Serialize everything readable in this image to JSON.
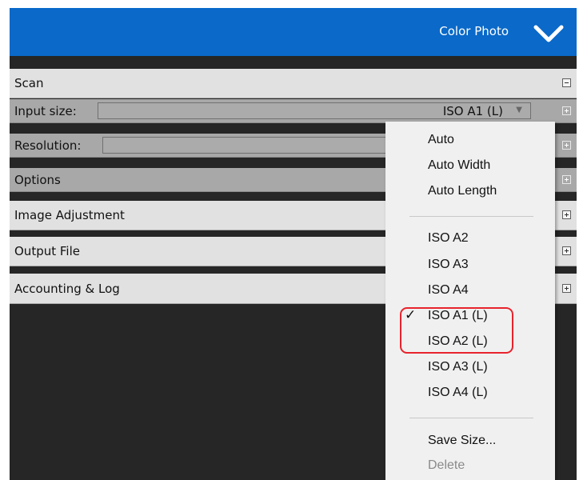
{
  "header": {
    "title": "Color Photo",
    "expand_icon": "chevron-down-icon"
  },
  "panels": {
    "scan": {
      "label": "Scan",
      "state_icon": "collapse-minus-icon"
    },
    "input_size": {
      "label": "Input size:",
      "value": "ISO A1 (L)",
      "state_icon": "expand-plus-icon"
    },
    "resolution": {
      "label": "Resolution:",
      "state_icon": "expand-plus-icon"
    },
    "options": {
      "label": "Options",
      "state_icon": "expand-plus-icon"
    },
    "image_adjustment": {
      "label": "Image Adjustment",
      "state_icon": "expand-plus-icon"
    },
    "output_file": {
      "label": "Output File",
      "state_icon": "expand-plus-icon"
    },
    "accounting_log": {
      "label": "Accounting & Log",
      "state_icon": "expand-plus-icon"
    }
  },
  "dropdown": {
    "items": [
      "Auto",
      "Auto Width",
      "Auto Length",
      "ISO A2",
      "ISO A3",
      "ISO A4",
      "ISO A1 (L)",
      "ISO A2 (L)",
      "ISO A3 (L)",
      "ISO A4 (L)",
      "Save Size...",
      "Delete"
    ],
    "selected": "ISO A1 (L)",
    "checkmark": "✓",
    "disabled": [
      "Delete"
    ],
    "highlight_color": "#e8232d"
  },
  "colors": {
    "header_bg": "#0a69c9",
    "panel_bg": "#e1e1e1",
    "subpanel_bg": "#a8a8a8",
    "canvas_bg": "#262626",
    "menu_bg": "#f0f0f0"
  }
}
